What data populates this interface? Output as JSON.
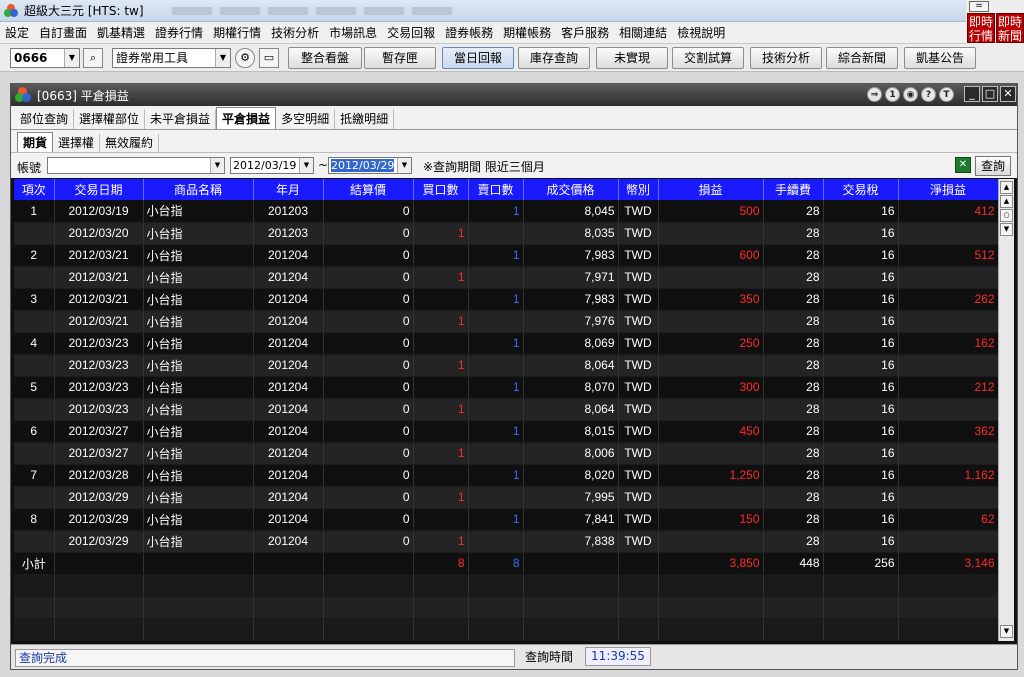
{
  "app": {
    "title": "超級大三元 [HTS: tw]"
  },
  "topright": {
    "mini": "=",
    "btn1": "即時行情",
    "btn2": "即時新聞"
  },
  "menu": [
    "設定",
    "自訂畫面",
    "凱基精選",
    "證券行情",
    "期權行情",
    "技術分析",
    "市場訊息",
    "交易回報",
    "證券帳務",
    "期權帳務",
    "客戶服務",
    "相關連結",
    "檢視說明"
  ],
  "toolbar": {
    "stock_code": "0666",
    "tool_combo": "證券常用工具",
    "buttons": [
      "整合看盤",
      "暫存匣",
      "當日回報",
      "庫存查詢",
      "未實現",
      "交割試算",
      "技術分析",
      "綜合新聞",
      "凱基公告"
    ]
  },
  "window": {
    "title": "[0663] 平倉損益",
    "icons": [
      "⇒",
      "1",
      "◉",
      "?",
      "T"
    ]
  },
  "tabs": [
    "部位查詢",
    "選擇權部位",
    "未平倉損益",
    "平倉損益",
    "多空明細",
    "抵繳明細"
  ],
  "subtabs": [
    "期貨",
    "選擇權",
    "無效履約"
  ],
  "filter": {
    "account_label": "帳號",
    "account_value": "",
    "date_from": "2012/03/19",
    "tilde": "~",
    "date_to": "2012/03/29",
    "note": "※查詢期間 限近三個月",
    "query_button": "查詢"
  },
  "table": {
    "columns": [
      "項次",
      "交易日期",
      "商品名稱",
      "年月",
      "結算價",
      "買口數",
      "賣口數",
      "成交價格",
      "幣別",
      "損益",
      "手續費",
      "交易稅",
      "淨損益"
    ],
    "rows": [
      [
        "1",
        "2012/03/19",
        "小台指",
        "201203",
        "0",
        "",
        "1",
        "8,045",
        "TWD",
        "500",
        "28",
        "16",
        "412"
      ],
      [
        "",
        "2012/03/20",
        "小台指",
        "201203",
        "0",
        "1",
        "",
        "8,035",
        "TWD",
        "",
        "28",
        "16",
        ""
      ],
      [
        "2",
        "2012/03/21",
        "小台指",
        "201204",
        "0",
        "",
        "1",
        "7,983",
        "TWD",
        "600",
        "28",
        "16",
        "512"
      ],
      [
        "",
        "2012/03/21",
        "小台指",
        "201204",
        "0",
        "1",
        "",
        "7,971",
        "TWD",
        "",
        "28",
        "16",
        ""
      ],
      [
        "3",
        "2012/03/21",
        "小台指",
        "201204",
        "0",
        "",
        "1",
        "7,983",
        "TWD",
        "350",
        "28",
        "16",
        "262"
      ],
      [
        "",
        "2012/03/21",
        "小台指",
        "201204",
        "0",
        "1",
        "",
        "7,976",
        "TWD",
        "",
        "28",
        "16",
        ""
      ],
      [
        "4",
        "2012/03/23",
        "小台指",
        "201204",
        "0",
        "",
        "1",
        "8,069",
        "TWD",
        "250",
        "28",
        "16",
        "162"
      ],
      [
        "",
        "2012/03/23",
        "小台指",
        "201204",
        "0",
        "1",
        "",
        "8,064",
        "TWD",
        "",
        "28",
        "16",
        ""
      ],
      [
        "5",
        "2012/03/23",
        "小台指",
        "201204",
        "0",
        "",
        "1",
        "8,070",
        "TWD",
        "300",
        "28",
        "16",
        "212"
      ],
      [
        "",
        "2012/03/23",
        "小台指",
        "201204",
        "0",
        "1",
        "",
        "8,064",
        "TWD",
        "",
        "28",
        "16",
        ""
      ],
      [
        "6",
        "2012/03/27",
        "小台指",
        "201204",
        "0",
        "",
        "1",
        "8,015",
        "TWD",
        "450",
        "28",
        "16",
        "362"
      ],
      [
        "",
        "2012/03/27",
        "小台指",
        "201204",
        "0",
        "1",
        "",
        "8,006",
        "TWD",
        "",
        "28",
        "16",
        ""
      ],
      [
        "7",
        "2012/03/28",
        "小台指",
        "201204",
        "0",
        "",
        "1",
        "8,020",
        "TWD",
        "1,250",
        "28",
        "16",
        "1,162"
      ],
      [
        "",
        "2012/03/29",
        "小台指",
        "201204",
        "0",
        "1",
        "",
        "7,995",
        "TWD",
        "",
        "28",
        "16",
        ""
      ],
      [
        "8",
        "2012/03/29",
        "小台指",
        "201204",
        "0",
        "",
        "1",
        "7,841",
        "TWD",
        "150",
        "28",
        "16",
        "62"
      ],
      [
        "",
        "2012/03/29",
        "小台指",
        "201204",
        "0",
        "1",
        "",
        "7,838",
        "TWD",
        "",
        "28",
        "16",
        ""
      ]
    ],
    "subtotal": [
      "小計",
      "",
      "",
      "",
      "",
      "8",
      "8",
      "",
      "",
      "3,850",
      "448",
      "256",
      "3,146"
    ]
  },
  "status": {
    "message": "查詢完成",
    "time_label": "查詢時間",
    "time_value": "11:39:55"
  },
  "colors": {
    "header_bg": "#1a1aff",
    "profit": "#ff2a2a",
    "sell": "#3a6bff"
  }
}
